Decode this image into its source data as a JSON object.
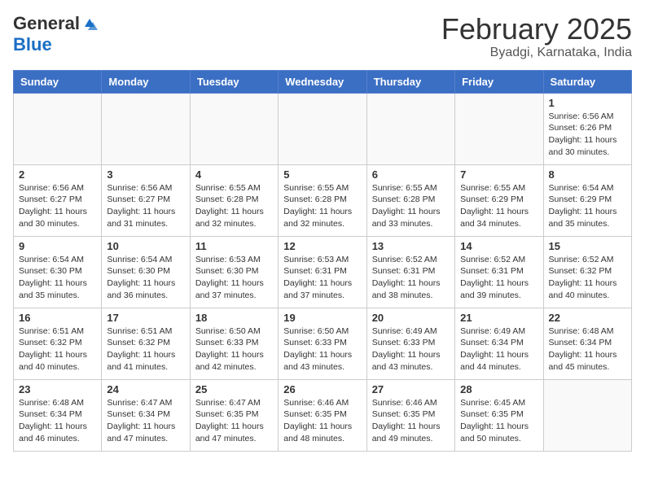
{
  "header": {
    "logo_general": "General",
    "logo_blue": "Blue",
    "month_title": "February 2025",
    "subtitle": "Byadgi, Karnataka, India"
  },
  "weekdays": [
    "Sunday",
    "Monday",
    "Tuesday",
    "Wednesday",
    "Thursday",
    "Friday",
    "Saturday"
  ],
  "weeks": [
    [
      {
        "day": "",
        "info": ""
      },
      {
        "day": "",
        "info": ""
      },
      {
        "day": "",
        "info": ""
      },
      {
        "day": "",
        "info": ""
      },
      {
        "day": "",
        "info": ""
      },
      {
        "day": "",
        "info": ""
      },
      {
        "day": "1",
        "info": "Sunrise: 6:56 AM\nSunset: 6:26 PM\nDaylight: 11 hours\nand 30 minutes."
      }
    ],
    [
      {
        "day": "2",
        "info": "Sunrise: 6:56 AM\nSunset: 6:27 PM\nDaylight: 11 hours\nand 30 minutes."
      },
      {
        "day": "3",
        "info": "Sunrise: 6:56 AM\nSunset: 6:27 PM\nDaylight: 11 hours\nand 31 minutes."
      },
      {
        "day": "4",
        "info": "Sunrise: 6:55 AM\nSunset: 6:28 PM\nDaylight: 11 hours\nand 32 minutes."
      },
      {
        "day": "5",
        "info": "Sunrise: 6:55 AM\nSunset: 6:28 PM\nDaylight: 11 hours\nand 32 minutes."
      },
      {
        "day": "6",
        "info": "Sunrise: 6:55 AM\nSunset: 6:28 PM\nDaylight: 11 hours\nand 33 minutes."
      },
      {
        "day": "7",
        "info": "Sunrise: 6:55 AM\nSunset: 6:29 PM\nDaylight: 11 hours\nand 34 minutes."
      },
      {
        "day": "8",
        "info": "Sunrise: 6:54 AM\nSunset: 6:29 PM\nDaylight: 11 hours\nand 35 minutes."
      }
    ],
    [
      {
        "day": "9",
        "info": "Sunrise: 6:54 AM\nSunset: 6:30 PM\nDaylight: 11 hours\nand 35 minutes."
      },
      {
        "day": "10",
        "info": "Sunrise: 6:54 AM\nSunset: 6:30 PM\nDaylight: 11 hours\nand 36 minutes."
      },
      {
        "day": "11",
        "info": "Sunrise: 6:53 AM\nSunset: 6:30 PM\nDaylight: 11 hours\nand 37 minutes."
      },
      {
        "day": "12",
        "info": "Sunrise: 6:53 AM\nSunset: 6:31 PM\nDaylight: 11 hours\nand 37 minutes."
      },
      {
        "day": "13",
        "info": "Sunrise: 6:52 AM\nSunset: 6:31 PM\nDaylight: 11 hours\nand 38 minutes."
      },
      {
        "day": "14",
        "info": "Sunrise: 6:52 AM\nSunset: 6:31 PM\nDaylight: 11 hours\nand 39 minutes."
      },
      {
        "day": "15",
        "info": "Sunrise: 6:52 AM\nSunset: 6:32 PM\nDaylight: 11 hours\nand 40 minutes."
      }
    ],
    [
      {
        "day": "16",
        "info": "Sunrise: 6:51 AM\nSunset: 6:32 PM\nDaylight: 11 hours\nand 40 minutes."
      },
      {
        "day": "17",
        "info": "Sunrise: 6:51 AM\nSunset: 6:32 PM\nDaylight: 11 hours\nand 41 minutes."
      },
      {
        "day": "18",
        "info": "Sunrise: 6:50 AM\nSunset: 6:33 PM\nDaylight: 11 hours\nand 42 minutes."
      },
      {
        "day": "19",
        "info": "Sunrise: 6:50 AM\nSunset: 6:33 PM\nDaylight: 11 hours\nand 43 minutes."
      },
      {
        "day": "20",
        "info": "Sunrise: 6:49 AM\nSunset: 6:33 PM\nDaylight: 11 hours\nand 43 minutes."
      },
      {
        "day": "21",
        "info": "Sunrise: 6:49 AM\nSunset: 6:34 PM\nDaylight: 11 hours\nand 44 minutes."
      },
      {
        "day": "22",
        "info": "Sunrise: 6:48 AM\nSunset: 6:34 PM\nDaylight: 11 hours\nand 45 minutes."
      }
    ],
    [
      {
        "day": "23",
        "info": "Sunrise: 6:48 AM\nSunset: 6:34 PM\nDaylight: 11 hours\nand 46 minutes."
      },
      {
        "day": "24",
        "info": "Sunrise: 6:47 AM\nSunset: 6:34 PM\nDaylight: 11 hours\nand 47 minutes."
      },
      {
        "day": "25",
        "info": "Sunrise: 6:47 AM\nSunset: 6:35 PM\nDaylight: 11 hours\nand 47 minutes."
      },
      {
        "day": "26",
        "info": "Sunrise: 6:46 AM\nSunset: 6:35 PM\nDaylight: 11 hours\nand 48 minutes."
      },
      {
        "day": "27",
        "info": "Sunrise: 6:46 AM\nSunset: 6:35 PM\nDaylight: 11 hours\nand 49 minutes."
      },
      {
        "day": "28",
        "info": "Sunrise: 6:45 AM\nSunset: 6:35 PM\nDaylight: 11 hours\nand 50 minutes."
      },
      {
        "day": "",
        "info": ""
      }
    ]
  ]
}
